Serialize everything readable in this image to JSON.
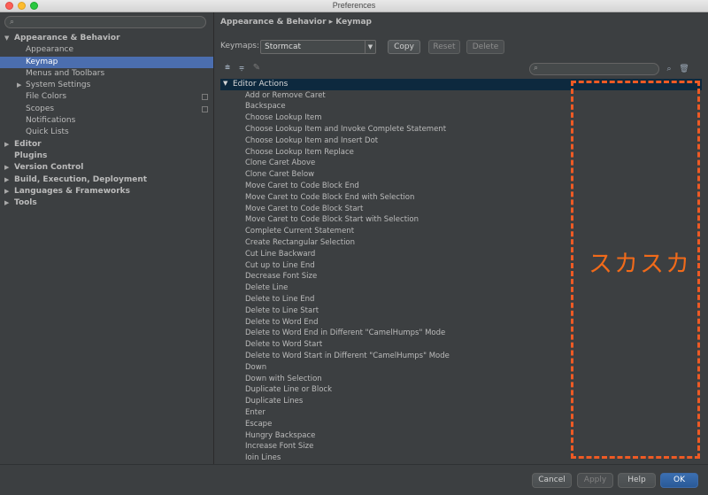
{
  "window": {
    "title": "Preferences"
  },
  "sidebar": {
    "search_placeholder": "",
    "tree": [
      {
        "label": "Appearance & Behavior",
        "level": 0,
        "expanded": true,
        "bold": true,
        "has_arrow": true
      },
      {
        "label": "Appearance",
        "level": 1
      },
      {
        "label": "Keymap",
        "level": 1,
        "selected": true
      },
      {
        "label": "Menus and Toolbars",
        "level": 1
      },
      {
        "label": "System Settings",
        "level": 1,
        "has_arrow": true
      },
      {
        "label": "File Colors",
        "level": 1,
        "copy_icon": true
      },
      {
        "label": "Scopes",
        "level": 1,
        "copy_icon": true
      },
      {
        "label": "Notifications",
        "level": 1
      },
      {
        "label": "Quick Lists",
        "level": 1
      },
      {
        "label": "Editor",
        "level": 0,
        "bold": true,
        "has_arrow": true
      },
      {
        "label": "Plugins",
        "level": 0,
        "bold": true
      },
      {
        "label": "Version Control",
        "level": 0,
        "bold": true,
        "has_arrow": true
      },
      {
        "label": "Build, Execution, Deployment",
        "level": 0,
        "bold": true,
        "has_arrow": true
      },
      {
        "label": "Languages & Frameworks",
        "level": 0,
        "bold": true,
        "has_arrow": true
      },
      {
        "label": "Tools",
        "level": 0,
        "bold": true,
        "has_arrow": true
      }
    ]
  },
  "main": {
    "breadcrumb": "Appearance & Behavior ▸ Keymap",
    "keymaps_label": "Keymaps:",
    "keymap_value": "Stormcat",
    "copy_label": "Copy",
    "reset_label": "Reset",
    "delete_label": "Delete",
    "group_label": "Editor Actions",
    "actions": [
      "Add or Remove Caret",
      "Backspace",
      "Choose Lookup Item",
      "Choose Lookup Item and Invoke Complete Statement",
      "Choose Lookup Item and Insert Dot",
      "Choose Lookup Item Replace",
      "Clone Caret Above",
      "Clone Caret Below",
      "Move Caret to Code Block End",
      "Move Caret to Code Block End with Selection",
      "Move Caret to Code Block Start",
      "Move Caret to Code Block Start with Selection",
      "Complete Current Statement",
      "Create Rectangular Selection",
      "Cut Line Backward",
      "Cut up to Line End",
      "Decrease Font Size",
      "Delete Line",
      "Delete to Line End",
      "Delete to Line Start",
      "Delete to Word End",
      "Delete to Word End in Different \"CamelHumps\" Mode",
      "Delete to Word Start",
      "Delete to Word Start in Different \"CamelHumps\" Mode",
      "Down",
      "Down with Selection",
      "Duplicate Line or Block",
      "Duplicate Lines",
      "Enter",
      "Escape",
      "Hungry Backspace",
      "Increase Font Size",
      "Join Lines"
    ]
  },
  "annotation": {
    "text": "スカスカ",
    "color": "#ee5a24"
  },
  "footer": {
    "cancel_label": "Cancel",
    "apply_label": "Apply",
    "help_label": "Help",
    "ok_label": "OK"
  },
  "icons": {
    "search": "search-icon",
    "expand_all": "expand-all-icon",
    "collapse_all": "collapse-all-icon",
    "edit": "pencil-icon",
    "find_shortcut": "find-by-shortcut-icon",
    "remove": "trash-icon"
  }
}
